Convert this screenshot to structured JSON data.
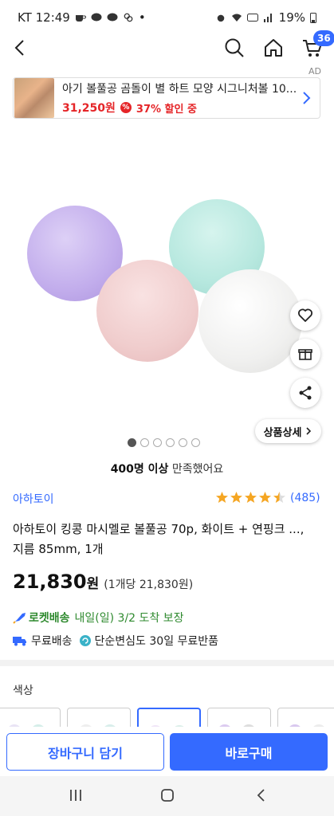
{
  "status_bar": {
    "carrier_time": "KT 12:49",
    "dot": "•",
    "battery": "19%"
  },
  "nav": {
    "cart_count": "36",
    "ad_label": "AD"
  },
  "ad": {
    "title": "아기 볼풀공 곰돌이 별 하트 모양 시그니처볼 10...",
    "price": "31,250원",
    "discount": "37% 할인 중"
  },
  "gallery": {
    "dot_count": 6,
    "active_dot": 0,
    "detail_button": "상품상세"
  },
  "satisfaction": {
    "bold": "400명 이상",
    "rest": " 만족했어요"
  },
  "product": {
    "brand": "아하토이",
    "rating": 4.5,
    "review_count": "(485)",
    "title": "아하토이 킹콩 마시멜로 볼풀공 70p, 화이트 + 연핑크 ..., 지름 85mm, 1개",
    "price": "21,830",
    "price_unit": "원",
    "unit_price": "(1개당 21,830원)"
  },
  "delivery": {
    "rocket_label": "로켓배송",
    "rocket_date": "내일(일) 3/2 도착 보장",
    "free_shipping": "무료배송",
    "free_return": "단순변심도 30일 무료반품"
  },
  "options": {
    "label": "색상"
  },
  "actions": {
    "add_to_cart": "장바구니 담기",
    "buy_now": "바로구매"
  },
  "colors": {
    "accent": "#346aff",
    "price_red": "#e52528",
    "rocket_green": "#2f8a2f",
    "star": "#f5a623"
  }
}
